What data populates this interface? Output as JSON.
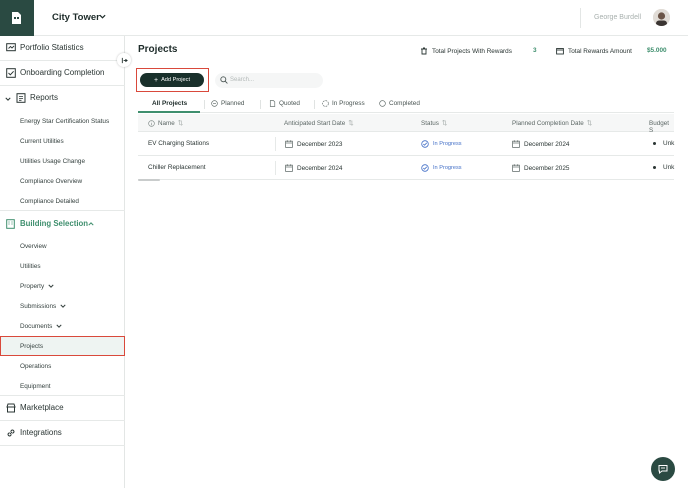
{
  "header": {
    "building_name": "City Tower",
    "user_name": "George Burdell"
  },
  "sidebar": {
    "portfolio_statistics": "Portfolio Statistics",
    "onboarding_completion": "Onboarding Completion",
    "reports": "Reports",
    "report_items": [
      "Energy Star Certification Status",
      "Current Utilities",
      "Utilities Usage Change",
      "Compliance Overview",
      "Compliance Detailed"
    ],
    "building_selection": "Building Selection",
    "building_items": {
      "overview": "Overview",
      "utilities": "Utilities",
      "property": "Property",
      "submissions": "Submissions",
      "documents": "Documents",
      "projects": "Projects",
      "operations": "Operations",
      "equipment": "Equipment"
    },
    "marketplace": "Marketplace",
    "integrations": "Integrations"
  },
  "main": {
    "title": "Projects",
    "total_projects_label": "Total Projects With Rewards",
    "total_projects_value": "3",
    "total_rewards_label": "Total Rewards Amount",
    "total_rewards_value": "$5.000",
    "add_project_label": "Add Project",
    "search_placeholder": "Search...",
    "tabs": [
      "All Projects",
      "Planned",
      "Quoted",
      "In Progress",
      "Completed"
    ],
    "columns": [
      "Name",
      "Anticipated Start Date",
      "Status",
      "Planned Completion Date",
      "Budget S"
    ],
    "rows": [
      {
        "name": "EV Charging Stations",
        "start": "December 2023",
        "status": "In Progress",
        "completion": "December 2024",
        "budget": "Unk"
      },
      {
        "name": "Chiller Replacement",
        "start": "December 2024",
        "status": "In Progress",
        "completion": "December 2025",
        "budget": "Unk"
      }
    ]
  },
  "colors": {
    "brand_dark": "#2a4a42",
    "accent_green": "#3f8f6e",
    "highlight_red": "#d9493b",
    "status_blue": "#4470c7"
  }
}
